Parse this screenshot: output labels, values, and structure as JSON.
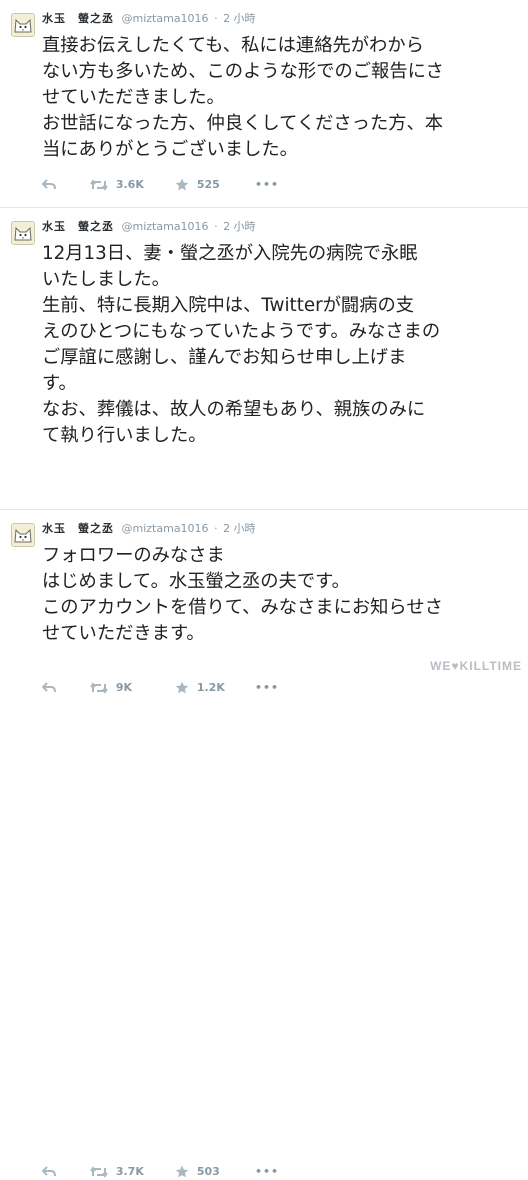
{
  "tweets": [
    {
      "name": "水玉　螢之丞",
      "handle": "@miztama1016",
      "time": "2 小時",
      "lines": [
        "直接お伝えしたくても、私には連絡先がわから",
        "ない方も多いため、このような形でのご報告にさ",
        "せていただきました。",
        "お世話になった方、仲良くしてくださった方、本",
        "当にありがとうございました。"
      ],
      "retweets": "3.6K",
      "favorites": "525",
      "more": "•••"
    },
    {
      "name": "水玉　螢之丞",
      "handle": "@miztama1016",
      "time": "2 小時",
      "lines": [
        "12月13日、妻・螢之丞が入院先の病院で永眠",
        "いたしました。",
        "生前、特に長期入院中は、Twitterが闘病の支",
        "えのひとつにもなっていたようです。みなさまの",
        "ご厚誼に感謝し、謹んでお知らせ申し上げま",
        "す。",
        "なお、葬儀は、故人の希望もあり、親族のみに",
        "て執り行いました。"
      ],
      "retweets": "9K",
      "favorites": "1.2K",
      "more": "•••"
    },
    {
      "name": "水玉　螢之丞",
      "handle": "@miztama1016",
      "time": "2 小時",
      "lines": [
        "フォロワーのみなさま",
        "はじめまして。水玉螢之丞の夫です。",
        "このアカウントを借りて、みなさまにお知らせさ",
        "せていただきます。"
      ],
      "retweets": "3.7K",
      "favorites": "503",
      "more": "•••"
    }
  ],
  "watermark": "WE♥KILLTIME",
  "colors": {
    "meta": "#8899a6",
    "text": "#222222",
    "divider": "#e1e8ed"
  }
}
